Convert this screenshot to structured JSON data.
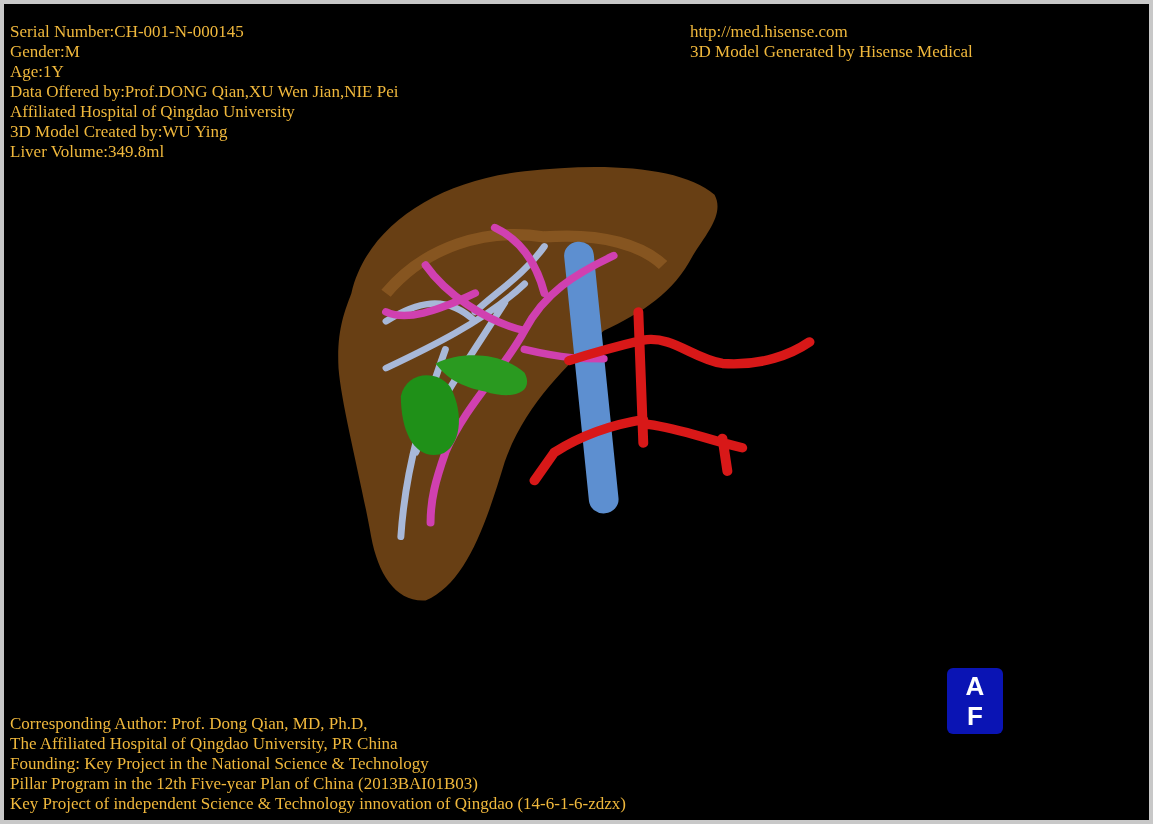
{
  "header_left": [
    "Serial Number:CH-001-N-000145",
    "Gender:M",
    "Age:1Y",
    "Data Offered by:Prof.DONG Qian,XU Wen Jian,NIE Pei",
    "Affiliated Hospital of Qingdao University",
    "3D Model Created by:WU Ying",
    "Liver Volume:349.8ml"
  ],
  "header_right": [
    "http://med.hisense.com",
    "3D Model Generated by Hisense Medical"
  ],
  "footer": [
    "Corresponding Author: Prof. Dong Qian, MD, Ph.D,",
    "The Affiliated Hospital of Qingdao University, PR China",
    "Founding: Key Project in the National Science & Technology",
    "Pillar Program in the 12th Five-year Plan of China (2013BAI01B03)",
    "Key Project of independent Science & Technology innovation of Qingdao (14-6-1-6-zdzx)"
  ],
  "orientation_cube": {
    "top": "A",
    "bottom": "F"
  }
}
